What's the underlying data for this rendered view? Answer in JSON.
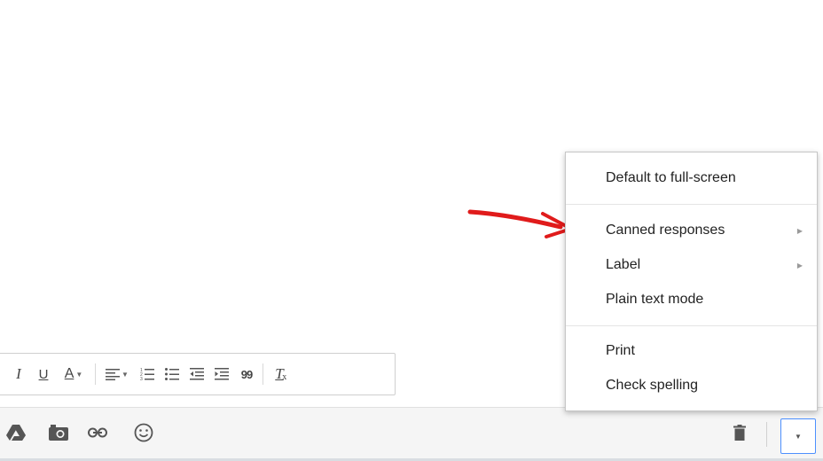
{
  "formatting_toolbar": {
    "italic_glyph": "I",
    "underline_glyph": "U",
    "text_color_glyph": "A",
    "quote_glyph": "99",
    "clear_format_glyph": "T"
  },
  "bottom_bar": {
    "icons": [
      "drive-icon",
      "photo-icon",
      "link-icon",
      "emoji-icon",
      "trash-icon",
      "more-options-icon"
    ]
  },
  "menu": {
    "items": [
      {
        "label": "Default to full-screen",
        "has_submenu": false
      },
      {
        "label": "Canned responses",
        "has_submenu": true
      },
      {
        "label": "Label",
        "has_submenu": true
      },
      {
        "label": "Plain text mode",
        "has_submenu": false
      },
      {
        "label": "Print",
        "has_submenu": false
      },
      {
        "label": "Check spelling",
        "has_submenu": false
      }
    ]
  },
  "colors": {
    "annotation_arrow": "#e01b1b",
    "focus_border": "#4d90fe",
    "icon_gray": "#444444"
  }
}
